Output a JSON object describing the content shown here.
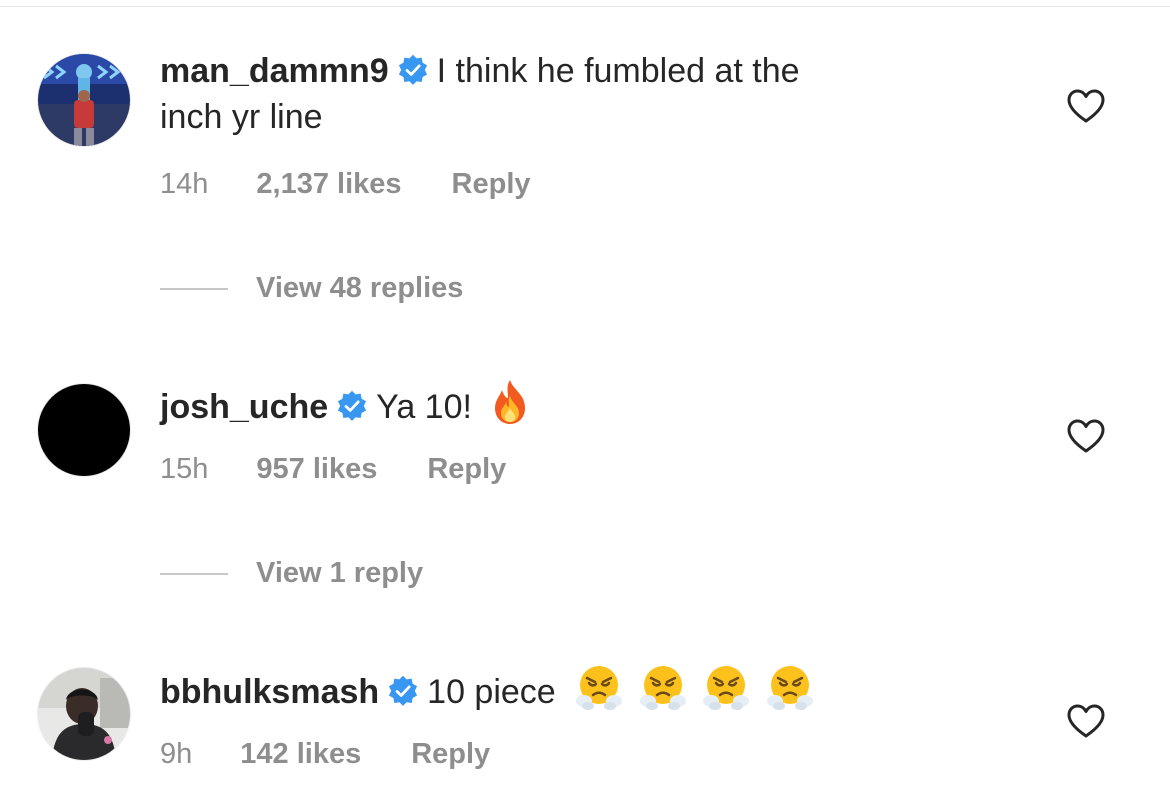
{
  "comments": [
    {
      "username": "man_dammn9",
      "text_line1": "I think he fumbled at the",
      "text_line2": "inch yr line",
      "time": "14h",
      "likes": "2,137 likes",
      "reply": "Reply",
      "view_replies": "View 48 replies",
      "verified": true
    },
    {
      "username": "josh_uche",
      "text": "Ya 10!",
      "emoji": "fire",
      "time": "15h",
      "likes": "957 likes",
      "reply": "Reply",
      "view_replies": "View 1 reply",
      "verified": true
    },
    {
      "username": "bbhulksmash",
      "text": "10 piece",
      "emoji": "face-with-steam-from-nose x4",
      "time": "9h",
      "likes": "142 likes",
      "reply": "Reply",
      "verified": true
    }
  ],
  "colors": {
    "text": "#262626",
    "secondary": "#8e8e8e",
    "verified_blue": "#3897f0",
    "divider": "#c7c7c7"
  },
  "icons": {
    "like": "heart-outline-icon",
    "verified": "verified-badge-icon"
  }
}
